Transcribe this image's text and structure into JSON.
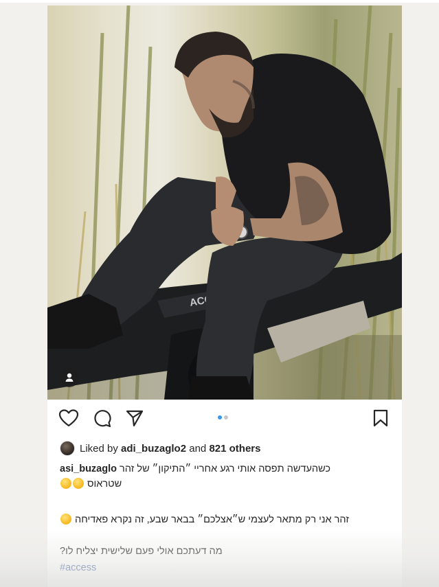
{
  "post": {
    "icons": {
      "like": "heart-icon",
      "comment": "comment-bubble-icon",
      "share": "paper-plane-icon",
      "save": "bookmark-icon",
      "user_tag": "person-icon"
    },
    "carousel": {
      "total": 2,
      "active_index": 0,
      "active_color": "#3897f0",
      "inactive_color": "#c7c7c7"
    },
    "likes": {
      "prefix": "Liked by",
      "liker": "adi_buzaglo2",
      "conjunction": "and",
      "others": "821 others"
    },
    "caption": {
      "username": "asi_buzaglo",
      "line1": "כשהעדשה תפסה אותי רגע אחריי ״התיקון״ של זהר",
      "line2": "שטראוס",
      "line3": "זהר אני רק מתאר לעצמי ש״אצלכם״ בבאר שבע, זה נקרא פאדיחה",
      "line4": "מה דעתכם אולי פעם שלישית יצליח לו?",
      "hashtag": "#access"
    },
    "colors": {
      "text": "#262626",
      "hashtag": "#385898",
      "background": "#f2f1ee"
    }
  }
}
